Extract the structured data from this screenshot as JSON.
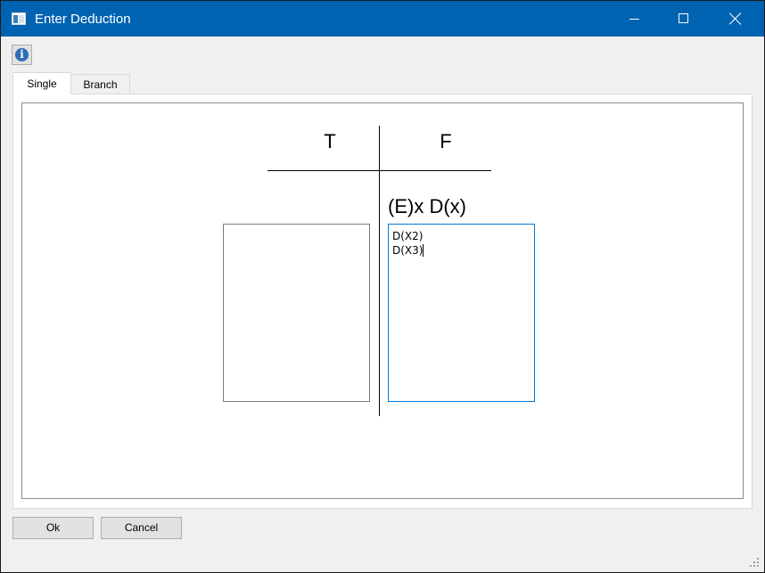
{
  "window": {
    "title": "Enter Deduction",
    "titlebar_color": "#0063b1"
  },
  "toolbar": {
    "info_glyph": "i"
  },
  "tabs": [
    {
      "label": "Single",
      "active": true
    },
    {
      "label": "Branch",
      "active": false
    }
  ],
  "tableau": {
    "true_header": "T",
    "false_header": "F",
    "formula": "(E)x D(x)",
    "true_entries": [],
    "false_entries": [
      "D(X2)",
      "D(X3)"
    ]
  },
  "buttons": {
    "ok": "Ok",
    "cancel": "Cancel"
  },
  "icons": {
    "app": "app-window-icon",
    "info": "info-icon",
    "minimize": "minimize-icon",
    "maximize": "maximize-icon",
    "close": "close-icon",
    "resize": "resize-grip-icon"
  }
}
